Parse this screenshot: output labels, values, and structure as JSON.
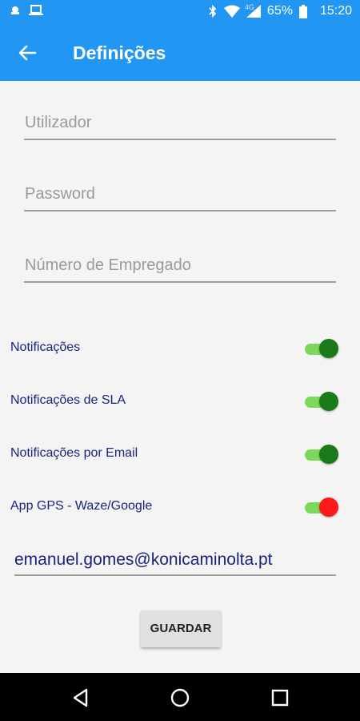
{
  "status_bar": {
    "time": "15:20",
    "battery_pct": "65%",
    "network": "4G",
    "icons": [
      "android-notification-icon",
      "laptop-icon",
      "bluetooth-icon",
      "wifi-icon",
      "signal-icon",
      "battery-icon"
    ]
  },
  "app_bar": {
    "title": "Definições",
    "back_icon": "arrow-left-icon"
  },
  "form": {
    "user_placeholder": "Utilizador",
    "password_placeholder": "Password",
    "employee_placeholder": "Número de Empregado"
  },
  "toggles": [
    {
      "label": "Notificações",
      "on": true,
      "thumb_color": "#1a7a1a"
    },
    {
      "label": "Notificações de SLA",
      "on": true,
      "thumb_color": "#1a7a1a"
    },
    {
      "label": "Notificações por Email",
      "on": true,
      "thumb_color": "#1a7a1a"
    },
    {
      "label": "App GPS - Waze/Google",
      "on": true,
      "thumb_color": "#ff1a1a"
    }
  ],
  "email": "emanuel.gomes@konicaminolta.pt",
  "save_label": "GUARDAR",
  "colors": {
    "primary": "#2196f3",
    "track_on": "#7cd85a",
    "text_dark_blue": "#1a237e"
  }
}
